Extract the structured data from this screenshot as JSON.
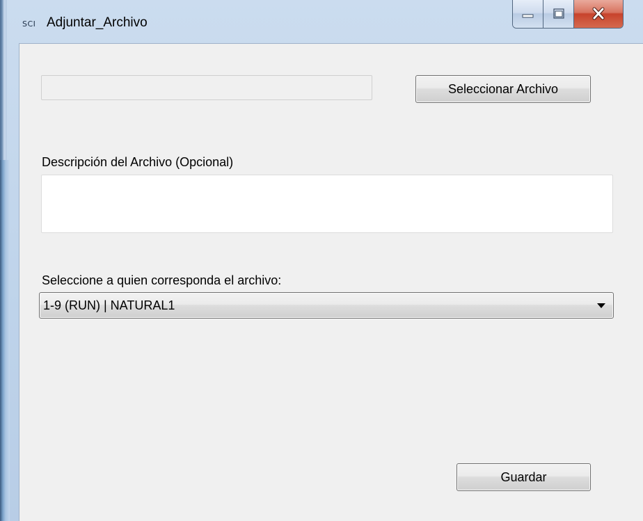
{
  "window": {
    "app_icon_text": "SCI",
    "title": "Adjuntar_Archivo",
    "caption_buttons": {
      "minimize_icon": "minimize-icon",
      "maximize_icon": "maximize-icon",
      "close_icon": "close-icon"
    }
  },
  "form": {
    "file_path": {
      "value": "",
      "placeholder": ""
    },
    "select_file_button": "Seleccionar Archivo",
    "description_label": "Descripción del Archivo (Opcional)",
    "description": {
      "value": "",
      "placeholder": ""
    },
    "owner_label": "Seleccione a quien corresponda el archivo:",
    "owner_select": {
      "selected": "1-9 (RUN) | NATURAL1"
    },
    "save_button": "Guardar"
  },
  "colors": {
    "client_background": "#f0f0f0",
    "titlebar": "#c5d8ee",
    "close_button": "#c7432c"
  }
}
